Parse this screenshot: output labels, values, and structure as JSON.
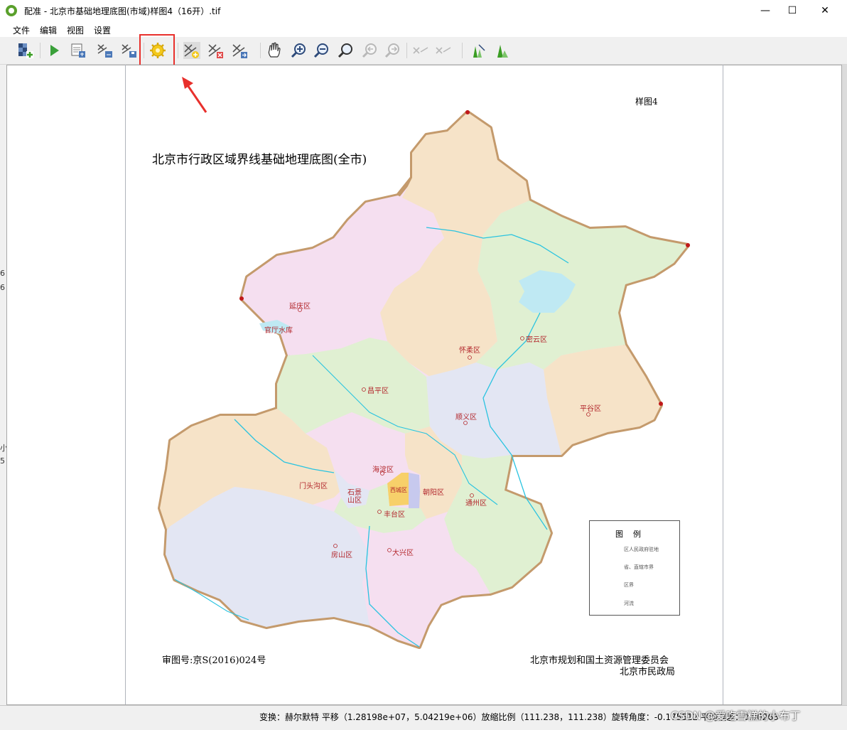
{
  "window": {
    "title": "配准 - 北京市基础地理底图(市域)样图4（16开）.tif",
    "minimize": "—",
    "maximize": "☐",
    "close": "✕"
  },
  "menu": [
    "文件",
    "编辑",
    "视图",
    "设置"
  ],
  "toolbar": {
    "icons": [
      "open-raster-icon",
      "start-georeferencing-icon",
      "generate-gdal-script-icon",
      "load-gcp-icon",
      "save-gcp-icon",
      "transformation-settings-icon",
      "add-point-icon",
      "delete-point-icon",
      "move-gcp-icon",
      "pan-icon",
      "zoom-in-icon",
      "zoom-out-icon",
      "zoom-to-layer-icon",
      "zoom-last-icon",
      "zoom-next-icon",
      "link-georef-to-qgis-icon",
      "link-qgis-to-georef-icon",
      "full-histogram-stretch-icon",
      "local-histogram-stretch-icon"
    ],
    "highlighted": "transformation-settings-icon",
    "accent": "#e8302c"
  },
  "map": {
    "sample_label": "样图4",
    "title": "北京市行政区域界线基础地理底图(全市)",
    "approval": "审图号:京S(2016)024号",
    "issuer_1": "北京市规划和国土资源管理委员会",
    "issuer_2": "北京市民政局",
    "districts": {
      "yanqing": "延庆区",
      "huairou": "怀柔区",
      "miyun": "密云区",
      "changping": "昌平区",
      "shunyi": "顺义区",
      "pinggu": "平谷区",
      "haidian": "海淀区",
      "mentougou": "门头沟区",
      "shijingshan_1": "石景",
      "shijingshan_2": "山区",
      "xicheng": "西城区",
      "chaoyang": "朝阳区",
      "fengtai": "丰台区",
      "tongzhou": "通州区",
      "fangshan": "房山区",
      "daxing": "大兴区",
      "reservoir": "官厅水库"
    },
    "legend": {
      "title": "图例",
      "items": [
        "区人民政府驻地",
        "省、直辖市界",
        "区界",
        "河流"
      ]
    },
    "colors": {
      "border": "#c49a6c",
      "pink": "#f5dff0",
      "tan": "#f6e3c8",
      "green": "#e0f0d2",
      "blue": "#e3e6f3",
      "river": "#29c3e0",
      "label": "#b3282d"
    }
  },
  "status": {
    "text": "变换：赫尔默特 平移（1.28198e+07，5.04219e+06）放缩比例（111.238，111.238）旋转角度：-0.175512 平均误差：0.00263",
    "watermark": "CSDN @爱吃雪糕的小布丁"
  },
  "left_edge": [
    "6",
    "6",
    "小",
    "5"
  ]
}
